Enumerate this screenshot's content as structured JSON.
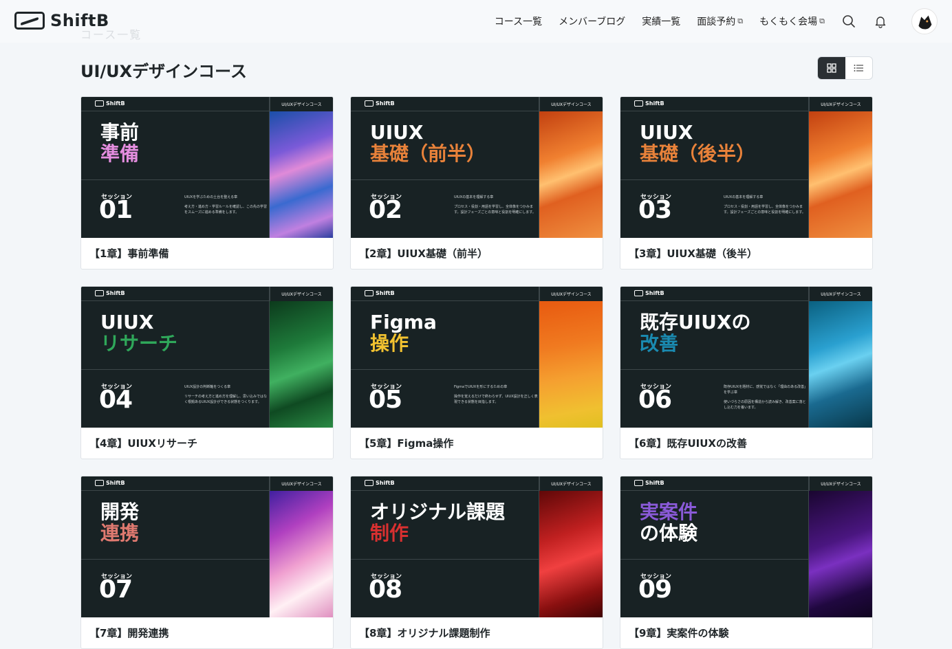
{
  "header": {
    "logo_text": "ShiftB",
    "nav": [
      {
        "label": "コース一覧",
        "external": false
      },
      {
        "label": "メンバーブログ",
        "external": false
      },
      {
        "label": "実績一覧",
        "external": false
      },
      {
        "label": "面談予約",
        "external": true
      },
      {
        "label": "もくもく会場",
        "external": true
      }
    ],
    "icons": [
      "search-icon",
      "bell-icon"
    ],
    "external_glyph": "⧉"
  },
  "breadcrumb_faded": "コース一覧",
  "page_title": "UI/UXデザインコース",
  "view_toggle": {
    "grid_icon": "grid-view-icon",
    "list_icon": "list-view-icon",
    "active": "grid"
  },
  "thumb_common": {
    "logo_text": "ShiftB",
    "course_tag": "UI/UXデザインコース",
    "session_label": "セッション"
  },
  "cards": [
    {
      "line1": "事前",
      "line2": "準備",
      "accent": "#e58ee0",
      "session": "01",
      "desc1": "UIUXを学ぶための土台を整える章",
      "desc2": "考え方・進め方・学習ルールを確認し、この先の学習をスムーズに進める準備をします。",
      "art": "linear-gradient(160deg,#1a4fa8 0%,#7a5ad8 30%,#e08ad8 45%,#3a6ad0 65%,#c080e0 85%,#2b3fa0 100%)",
      "label": "【1章】事前準備"
    },
    {
      "line1": "UIUX",
      "line2": "基礎（前半）",
      "accent": "#e8823a",
      "session": "02",
      "desc1": "UIUXの基本を理解する章",
      "desc2": "プロセス・役割・用語を学習し、全体像をつかみます。設計フェーズごとの意味と役割を明確にします。",
      "art": "linear-gradient(160deg,#c24010 0%,#f08030 35%,#ffc070 50%,#e06020 65%,#f09040 100%)",
      "label": "【2章】UIUX基礎（前半）"
    },
    {
      "line1": "UIUX",
      "line2": "基礎（後半）",
      "accent": "#e8823a",
      "session": "03",
      "desc1": "UIUXの基本を理解する章",
      "desc2": "プロセス・役割・用語を学習し、全体像をつかみます。設計フェーズごとの意味と役割を明確にします。",
      "art": "linear-gradient(160deg,#c24010 0%,#f08030 35%,#ffc070 50%,#e06020 65%,#f09040 100%)",
      "label": "【3章】UIUX基礎（後半）"
    },
    {
      "line1": "UIUX",
      "line2": "リサーチ",
      "accent": "#2fa85a",
      "session": "04",
      "desc1": "UIUX設計の判断軸をつくる章",
      "desc2": "リサーチの考え方と進め方を理解し、思い込みではなく根拠あるUIUX設計ができる状態をつくります。",
      "art": "linear-gradient(160deg,#0c3a1c 0%,#1e7a3a 35%,#40b060 55%,#0f4a22 75%,#2a8a44 100%)",
      "label": "【4章】UIUXリサーチ"
    },
    {
      "line1": "Figma",
      "line2": "操作",
      "accent": "#f2c230",
      "session": "05",
      "desc1": "FigmaでUIUXを形にするための章",
      "desc2": "操作を覚えるだけで終わらせず、UIUX設計を正しく表現できる状態を目指します。",
      "art": "linear-gradient(170deg,#e85a10 0%,#f07a20 35%,#f5a030 60%,#f0c030 85%,#e0c020 100%)",
      "label": "【5章】Figma操作"
    },
    {
      "line1": "既存UIUXの",
      "line2": "改善",
      "accent": "#1a8ab0",
      "session": "06",
      "desc1": "既存UIUXを題材に、感覚ではなく「理由のある改善」を学ぶ章",
      "desc2": "使いづらさの原因を構造から読み解き、改善案に落とし込む力を養います。",
      "art": "linear-gradient(160deg,#0a6080 0%,#2aa0d0 35%,#6ad0f0 50%,#1a6a90 70%,#08384a 100%)",
      "label": "【6章】既存UIUXの改善"
    },
    {
      "line1": "開発",
      "line2": "連携",
      "accent": "#e07a70",
      "session": "07",
      "desc1": "",
      "desc2": "",
      "art": "linear-gradient(150deg,#4020a0 0%,#b040c0 30%,#f0a0d0 55%,#fff0f4 75%,#e090c0 100%)",
      "label": "【7章】開発連携"
    },
    {
      "line1": "オリジナル課題",
      "line2": "制作",
      "accent": "#d83030",
      "session": "08",
      "desc1": "",
      "desc2": "",
      "art": "linear-gradient(160deg,#600808 0%,#c02020 35%,#f04040 55%,#8a1010 80%,#400404 100%)",
      "label": "【8章】オリジナル課題制作"
    },
    {
      "line1": "実案件",
      "line2": "の体験",
      "accent": "#8a5ad8",
      "session": "09",
      "desc1": "",
      "desc2": "",
      "art": "linear-gradient(160deg,#1a0630 0%,#4a1680 40%,#7a30c0 55%,#200840 80%,#100420 100%)",
      "label": "【9章】実案件の体験",
      "line1_accent": true
    }
  ]
}
